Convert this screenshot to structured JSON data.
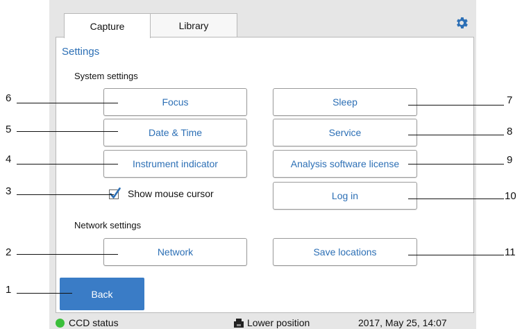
{
  "tabs": [
    {
      "label": "Capture"
    },
    {
      "label": "Library"
    }
  ],
  "header": {
    "icon": "gear-icon"
  },
  "panel": {
    "title": "Settings"
  },
  "system": {
    "label": "System settings",
    "focus": "Focus",
    "date_time": "Date & Time",
    "instrument_indicator": "Instrument indicator",
    "show_mouse_cursor": "Show mouse cursor",
    "show_mouse_cursor_checked": true,
    "sleep": "Sleep",
    "service": "Service",
    "analysis_license": "Analysis software license",
    "log_in": "Log in"
  },
  "network": {
    "label": "Network settings",
    "network": "Network",
    "save_locations": "Save locations"
  },
  "back_button": "Back",
  "status_bar": {
    "ccd_status": "CCD status",
    "ccd_color": "#3bbf3b",
    "position": "Lower position",
    "datetime": "2017, May 25, 14:07"
  },
  "callouts": {
    "c1": "1",
    "c2": "2",
    "c3": "3",
    "c4": "4",
    "c5": "5",
    "c6": "6",
    "c7": "7",
    "c8": "8",
    "c9": "9",
    "c10": "10",
    "c11": "11"
  },
  "colors": {
    "accent": "#2c6fb5",
    "back_button": "#3a7cc6"
  }
}
